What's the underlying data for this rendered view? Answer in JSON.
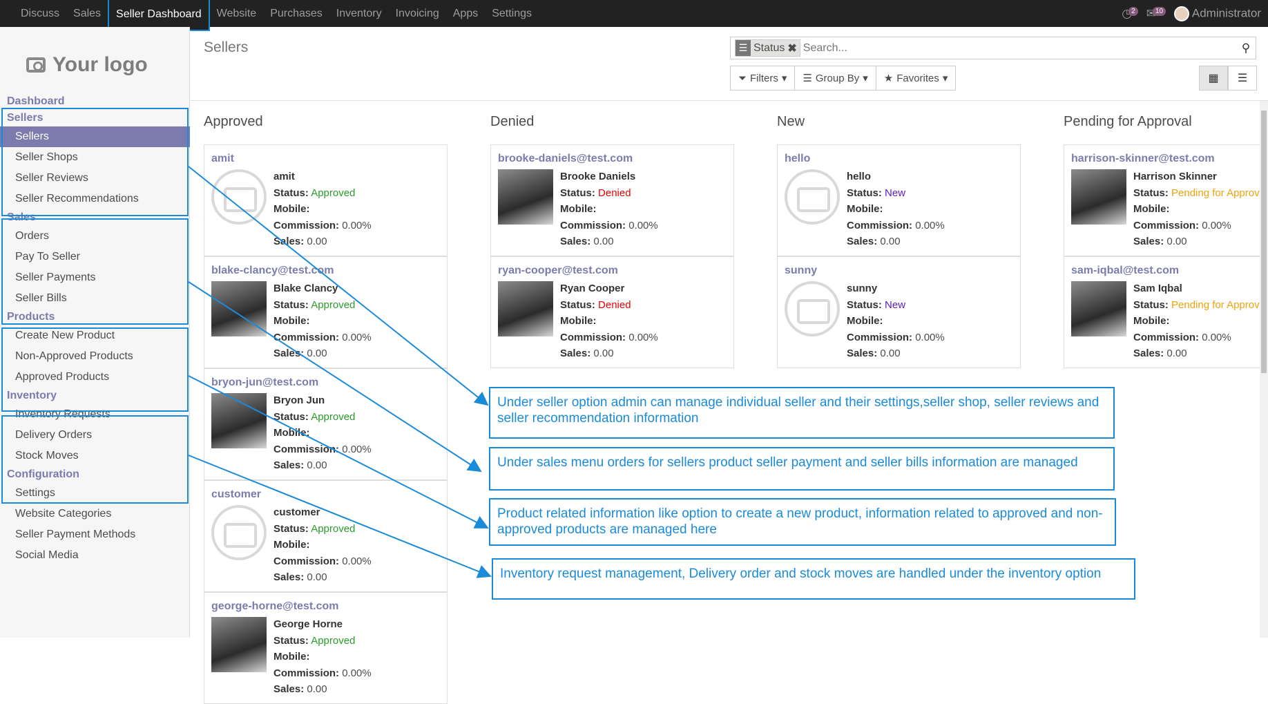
{
  "topbar": {
    "menu": [
      "Discuss",
      "Sales",
      "Seller Dashboard",
      "Website",
      "Purchases",
      "Inventory",
      "Invoicing",
      "Apps",
      "Settings"
    ],
    "activity_count": "2",
    "messages_count": "10",
    "user": "Administrator"
  },
  "sidebar": {
    "logo_text": "Your logo",
    "dashboard": "Dashboard",
    "sections": [
      {
        "title": "Sellers",
        "items": [
          "Sellers",
          "Seller Shops",
          "Seller Reviews",
          "Seller Recommendations"
        ]
      },
      {
        "title": "Sales",
        "items": [
          "Orders",
          "Pay To Seller",
          "Seller Payments",
          "Seller Bills"
        ]
      },
      {
        "title": "Products",
        "items": [
          "Create New Product",
          "Non-Approved Products",
          "Approved Products"
        ]
      },
      {
        "title": "Inventory",
        "items": [
          "Inventory Requests",
          "Delivery Orders",
          "Stock Moves"
        ]
      },
      {
        "title": "Configuration",
        "items": [
          "Settings",
          "Website Categories",
          "Seller Payment Methods",
          "Social Media"
        ]
      }
    ]
  },
  "control_panel": {
    "title": "Sellers",
    "facet_label": "Status",
    "search_placeholder": "Search...",
    "filters_label": "Filters",
    "groupby_label": "Group By",
    "favorites_label": "Favorites"
  },
  "labels": {
    "status": "Status:",
    "mobile": "Mobile:",
    "commission": "Commission:",
    "sales": "Sales:"
  },
  "columns": [
    {
      "title": "Approved",
      "cards": [
        {
          "name": "amit",
          "display": "amit",
          "status": "Approved",
          "commission": "0.00%",
          "sales": "0.00"
        },
        {
          "name": "blake-clancy@test.com",
          "display": "Blake Clancy",
          "status": "Approved",
          "commission": "0.00%",
          "sales": "0.00"
        },
        {
          "name": "bryon-jun@test.com",
          "display": "Bryon Jun",
          "status": "Approved",
          "commission": "0.00%",
          "sales": "0.00"
        },
        {
          "name": "customer",
          "display": "customer",
          "status": "Approved",
          "commission": "0.00%",
          "sales": "0.00"
        },
        {
          "name": "george-horne@test.com",
          "display": "George Horne",
          "status": "Approved",
          "commission": "0.00%",
          "sales": "0.00"
        }
      ]
    },
    {
      "title": "Denied",
      "cards": [
        {
          "name": "brooke-daniels@test.com",
          "display": "Brooke Daniels",
          "status": "Denied",
          "commission": "0.00%",
          "sales": "0.00"
        },
        {
          "name": "ryan-cooper@test.com",
          "display": "Ryan Cooper",
          "status": "Denied",
          "commission": "0.00%",
          "sales": "0.00"
        }
      ]
    },
    {
      "title": "New",
      "cards": [
        {
          "name": "hello",
          "display": "hello",
          "status": "New",
          "commission": "0.00%",
          "sales": "0.00"
        },
        {
          "name": "sunny",
          "display": "sunny",
          "status": "New",
          "commission": "0.00%",
          "sales": "0.00"
        }
      ]
    },
    {
      "title": "Pending for Approval",
      "cards": [
        {
          "name": "harrison-skinner@test.com",
          "display": "Harrison Skinner",
          "status": "Pending for Approv",
          "commission": "0.00%",
          "sales": "0.00"
        },
        {
          "name": "sam-iqbal@test.com",
          "display": "Sam Iqbal",
          "status": "Pending for Approv",
          "commission": "0.00%",
          "sales": "0.00"
        }
      ]
    }
  ],
  "notes": [
    "Under seller option admin can manage individual seller and their settings,seller shop, seller reviews and seller recommendation information",
    "Under sales menu orders for sellers product seller payment and seller bills information are managed",
    "Product related information like option to create a new product, information related to approved and non-approved products are managed here",
    "Inventory request management, Delivery order and stock moves are handled under the inventory option"
  ],
  "colors": {
    "accent": "#7c7bad",
    "annotation": "#1a8bd9",
    "approved": "#2b9b2b",
    "denied": "#e00000",
    "new": "#5b1bc6",
    "pending": "#f0a20b"
  }
}
